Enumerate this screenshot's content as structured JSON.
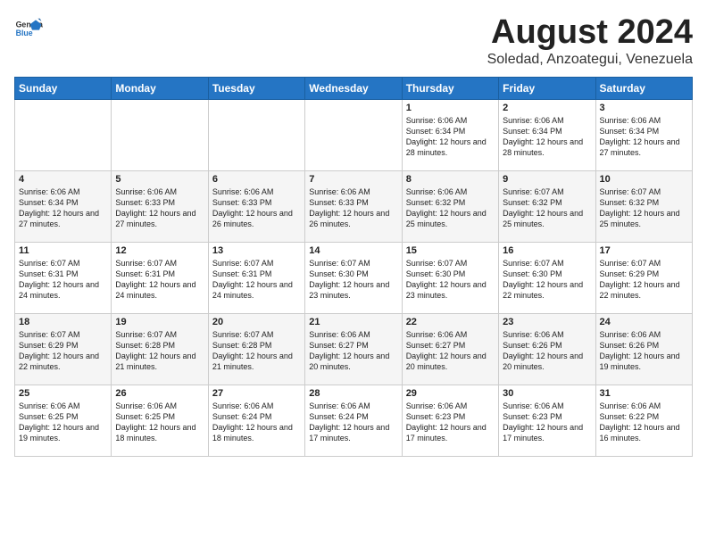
{
  "logo": {
    "general": "General",
    "blue": "Blue"
  },
  "title": "August 2024",
  "subtitle": "Soledad, Anzoategui, Venezuela",
  "headers": [
    "Sunday",
    "Monday",
    "Tuesday",
    "Wednesday",
    "Thursday",
    "Friday",
    "Saturday"
  ],
  "weeks": [
    [
      {
        "day": "",
        "info": ""
      },
      {
        "day": "",
        "info": ""
      },
      {
        "day": "",
        "info": ""
      },
      {
        "day": "",
        "info": ""
      },
      {
        "day": "1",
        "info": "Sunrise: 6:06 AM\nSunset: 6:34 PM\nDaylight: 12 hours\nand 28 minutes."
      },
      {
        "day": "2",
        "info": "Sunrise: 6:06 AM\nSunset: 6:34 PM\nDaylight: 12 hours\nand 28 minutes."
      },
      {
        "day": "3",
        "info": "Sunrise: 6:06 AM\nSunset: 6:34 PM\nDaylight: 12 hours\nand 27 minutes."
      }
    ],
    [
      {
        "day": "4",
        "info": "Sunrise: 6:06 AM\nSunset: 6:34 PM\nDaylight: 12 hours\nand 27 minutes."
      },
      {
        "day": "5",
        "info": "Sunrise: 6:06 AM\nSunset: 6:33 PM\nDaylight: 12 hours\nand 27 minutes."
      },
      {
        "day": "6",
        "info": "Sunrise: 6:06 AM\nSunset: 6:33 PM\nDaylight: 12 hours\nand 26 minutes."
      },
      {
        "day": "7",
        "info": "Sunrise: 6:06 AM\nSunset: 6:33 PM\nDaylight: 12 hours\nand 26 minutes."
      },
      {
        "day": "8",
        "info": "Sunrise: 6:06 AM\nSunset: 6:32 PM\nDaylight: 12 hours\nand 25 minutes."
      },
      {
        "day": "9",
        "info": "Sunrise: 6:07 AM\nSunset: 6:32 PM\nDaylight: 12 hours\nand 25 minutes."
      },
      {
        "day": "10",
        "info": "Sunrise: 6:07 AM\nSunset: 6:32 PM\nDaylight: 12 hours\nand 25 minutes."
      }
    ],
    [
      {
        "day": "11",
        "info": "Sunrise: 6:07 AM\nSunset: 6:31 PM\nDaylight: 12 hours\nand 24 minutes."
      },
      {
        "day": "12",
        "info": "Sunrise: 6:07 AM\nSunset: 6:31 PM\nDaylight: 12 hours\nand 24 minutes."
      },
      {
        "day": "13",
        "info": "Sunrise: 6:07 AM\nSunset: 6:31 PM\nDaylight: 12 hours\nand 24 minutes."
      },
      {
        "day": "14",
        "info": "Sunrise: 6:07 AM\nSunset: 6:30 PM\nDaylight: 12 hours\nand 23 minutes."
      },
      {
        "day": "15",
        "info": "Sunrise: 6:07 AM\nSunset: 6:30 PM\nDaylight: 12 hours\nand 23 minutes."
      },
      {
        "day": "16",
        "info": "Sunrise: 6:07 AM\nSunset: 6:30 PM\nDaylight: 12 hours\nand 22 minutes."
      },
      {
        "day": "17",
        "info": "Sunrise: 6:07 AM\nSunset: 6:29 PM\nDaylight: 12 hours\nand 22 minutes."
      }
    ],
    [
      {
        "day": "18",
        "info": "Sunrise: 6:07 AM\nSunset: 6:29 PM\nDaylight: 12 hours\nand 22 minutes."
      },
      {
        "day": "19",
        "info": "Sunrise: 6:07 AM\nSunset: 6:28 PM\nDaylight: 12 hours\nand 21 minutes."
      },
      {
        "day": "20",
        "info": "Sunrise: 6:07 AM\nSunset: 6:28 PM\nDaylight: 12 hours\nand 21 minutes."
      },
      {
        "day": "21",
        "info": "Sunrise: 6:06 AM\nSunset: 6:27 PM\nDaylight: 12 hours\nand 20 minutes."
      },
      {
        "day": "22",
        "info": "Sunrise: 6:06 AM\nSunset: 6:27 PM\nDaylight: 12 hours\nand 20 minutes."
      },
      {
        "day": "23",
        "info": "Sunrise: 6:06 AM\nSunset: 6:26 PM\nDaylight: 12 hours\nand 20 minutes."
      },
      {
        "day": "24",
        "info": "Sunrise: 6:06 AM\nSunset: 6:26 PM\nDaylight: 12 hours\nand 19 minutes."
      }
    ],
    [
      {
        "day": "25",
        "info": "Sunrise: 6:06 AM\nSunset: 6:25 PM\nDaylight: 12 hours\nand 19 minutes."
      },
      {
        "day": "26",
        "info": "Sunrise: 6:06 AM\nSunset: 6:25 PM\nDaylight: 12 hours\nand 18 minutes."
      },
      {
        "day": "27",
        "info": "Sunrise: 6:06 AM\nSunset: 6:24 PM\nDaylight: 12 hours\nand 18 minutes."
      },
      {
        "day": "28",
        "info": "Sunrise: 6:06 AM\nSunset: 6:24 PM\nDaylight: 12 hours\nand 17 minutes."
      },
      {
        "day": "29",
        "info": "Sunrise: 6:06 AM\nSunset: 6:23 PM\nDaylight: 12 hours\nand 17 minutes."
      },
      {
        "day": "30",
        "info": "Sunrise: 6:06 AM\nSunset: 6:23 PM\nDaylight: 12 hours\nand 17 minutes."
      },
      {
        "day": "31",
        "info": "Sunrise: 6:06 AM\nSunset: 6:22 PM\nDaylight: 12 hours\nand 16 minutes."
      }
    ]
  ]
}
